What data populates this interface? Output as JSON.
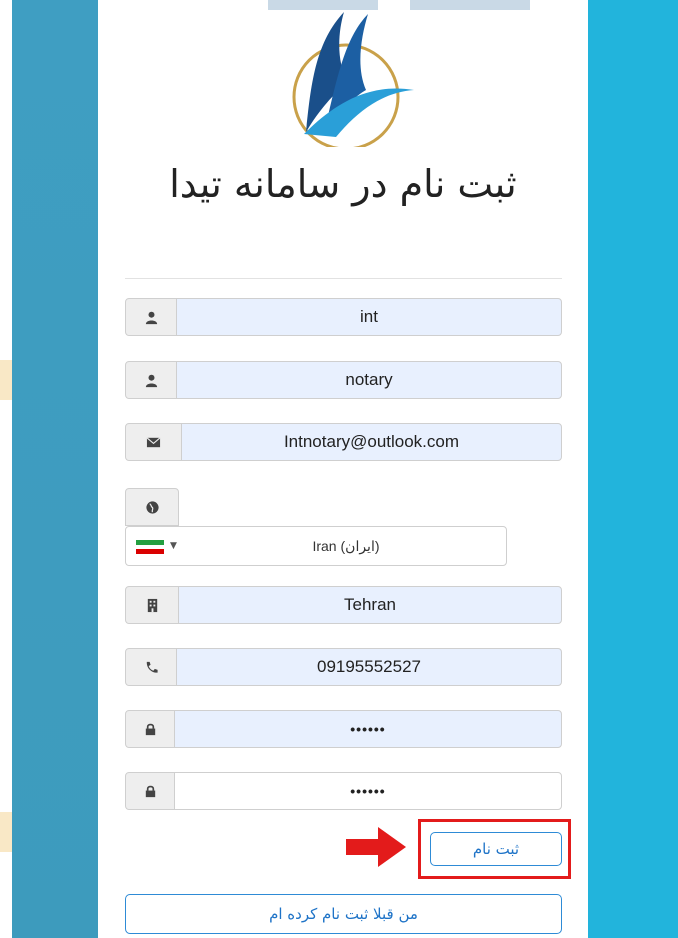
{
  "page": {
    "title": "ثبت نام در سامانه تیدا"
  },
  "form": {
    "first_name": "int",
    "last_name": "notary",
    "email": "Intnotary@outlook.com",
    "country": "Iran (ایران)",
    "city": "Tehran",
    "phone": "09195552527",
    "password": "••••••",
    "password_confirm": "••••••"
  },
  "buttons": {
    "submit_label": "ثبت نام",
    "login_label": "من قبلا ثبت نام کرده ام"
  },
  "icons": {
    "first_name": "user-icon",
    "last_name": "user-icon",
    "email": "envelope-icon",
    "country": "globe-icon",
    "city": "building-icon",
    "phone": "phone-icon",
    "password": "lock-icon",
    "password_confirm": "lock-icon",
    "annotation": "red-arrow"
  },
  "colors": {
    "accent": "#1e73c7",
    "highlight": "#e31b1b",
    "autofill": "#e8f0fe",
    "bg_left": "#3f9ec2",
    "bg_right": "#22b4dc"
  }
}
